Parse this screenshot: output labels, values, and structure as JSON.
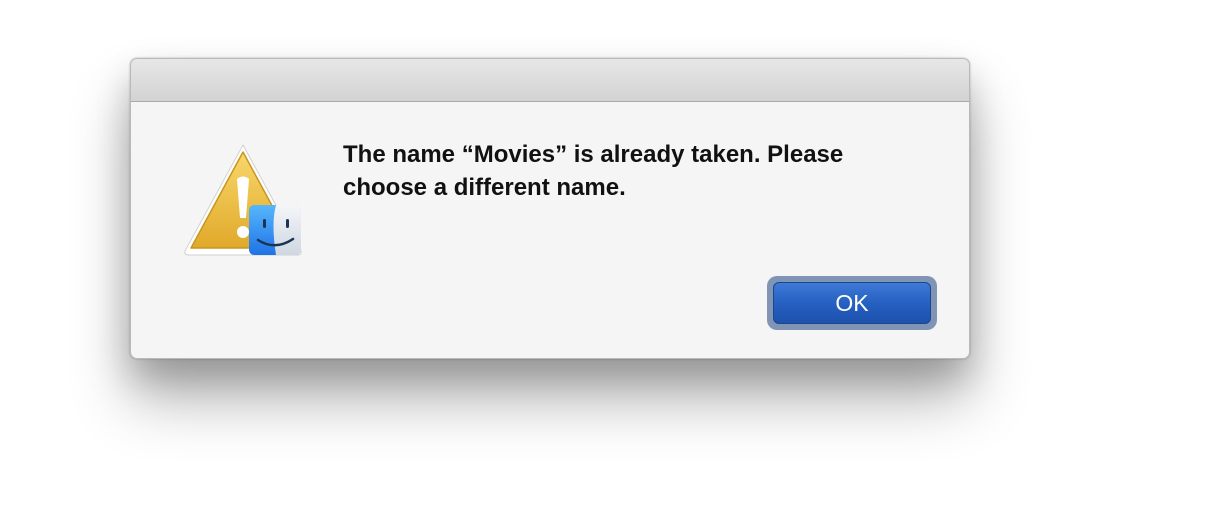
{
  "dialog": {
    "message": "The name “Movies” is already taken. Please choose a different name.",
    "ok_label": "OK",
    "icons": [
      "warning-triangle-icon",
      "finder-icon"
    ],
    "colors": {
      "button": "#2660c2",
      "focus_ring": "#8094b6",
      "warning": "#efb92e"
    }
  }
}
